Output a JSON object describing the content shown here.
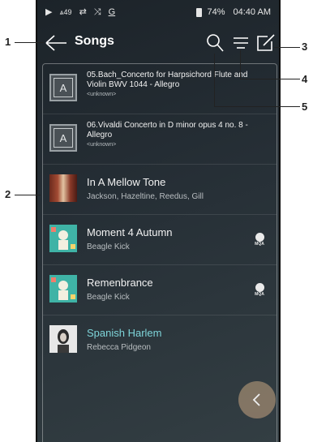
{
  "status_bar": {
    "play_icon": "play-icon",
    "signal_text": "49",
    "battery_percent": "74%",
    "time": "04:40 AM"
  },
  "header": {
    "title": "Songs"
  },
  "songs": [
    {
      "title": "05.Bach_Concerto for Harpsichord Flute and Violin BWV 1044 - Allegro",
      "artist": "<unknown>",
      "art": "generic-A",
      "mqa": false
    },
    {
      "title": "06.Vivaldi Concerto in D minor opus 4 no. 8 - Allegro",
      "artist": "<unknown>",
      "art": "generic-A",
      "mqa": false
    },
    {
      "title": "In A Mellow Tone",
      "artist": "Jackson, Hazeltine, Reedus, Gill",
      "art": "mellow-tone-cover",
      "mqa": false
    },
    {
      "title": "Moment 4 Autumn",
      "artist": "Beagle Kick",
      "art": "beagle-kick-cover",
      "mqa": true
    },
    {
      "title": "Remenbrance",
      "artist": "Beagle Kick",
      "art": "beagle-kick-cover",
      "mqa": true
    },
    {
      "title": "Spanish Harlem",
      "artist": "Rebecca Pidgeon",
      "art": "pidgeon-cover",
      "mqa": false,
      "playing": true
    }
  ],
  "mqa_label": "MQA",
  "art_letter": "A",
  "callouts": [
    "1",
    "2",
    "3",
    "4",
    "5"
  ],
  "colors": {
    "background": "#262f36",
    "playing_title": "#7ed4d9",
    "fab": "#8a7a67"
  }
}
